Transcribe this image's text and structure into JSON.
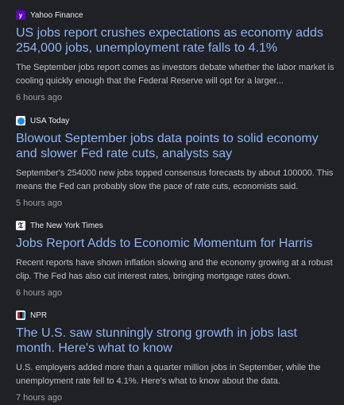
{
  "articles": [
    {
      "source": "Yahoo Finance",
      "icon": "yahoo-finance-icon",
      "headline": "US jobs report crushes expectations as economy adds 254,000 jobs, unemployment rate falls to 4.1%",
      "snippet": "The September jobs report comes as investors debate whether the labor market is cooling quickly enough that the Federal Reserve will opt for a larger...",
      "time": "6 hours ago"
    },
    {
      "source": "USA Today",
      "icon": "usa-today-icon",
      "headline": "Blowout September jobs data points to solid economy and slower Fed rate cuts, analysts say",
      "snippet": "September's 254000 new jobs topped consensus forecasts by about 100000. This means the Fed can probably slow the pace of rate cuts, economists said.",
      "time": "5 hours ago"
    },
    {
      "source": "The New York Times",
      "icon": "new-york-times-icon",
      "headline": "Jobs Report Adds to Economic Momentum for Harris",
      "snippet": "Recent reports have shown inflation slowing and the economy growing at a robust clip. The Fed has also cut interest rates, bringing mortgage rates down.",
      "time": "6 hours ago"
    },
    {
      "source": "NPR",
      "icon": "npr-icon",
      "headline": "The U.S. saw stunningly strong growth in jobs last month. Here's what to know",
      "snippet": "U.S. employers added more than a quarter million jobs in September, while the unemployment rate fell to 4.1%. Here's what to know about the data.",
      "time": "7 hours ago"
    }
  ],
  "colors": {
    "background": "#202124",
    "headline": "#8ab4f8",
    "snippet": "#bdc1c6",
    "time": "#9aa0a6",
    "source": "#e8eaed"
  }
}
